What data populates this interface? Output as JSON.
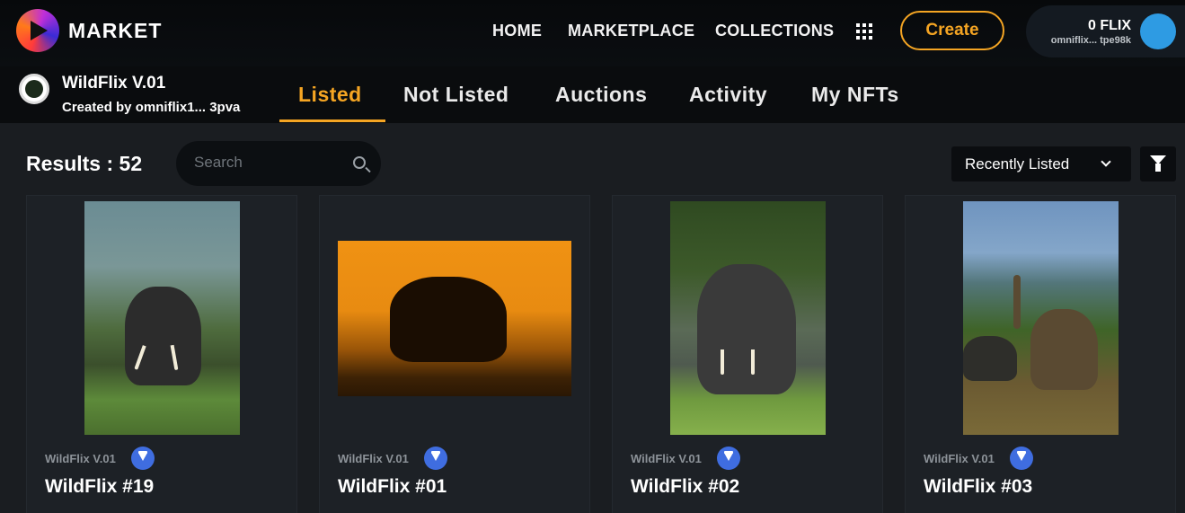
{
  "topnav": {
    "brand": "MARKET",
    "links": [
      "HOME",
      "MARKETPLACE",
      "COLLECTIONS"
    ],
    "create_label": "Create",
    "wallet": {
      "balance": "0 FLIX",
      "address": "omniflix...  tpe98k"
    }
  },
  "collection": {
    "name": "WildFlix V.01",
    "created_by": "Created by  omniflix1...  3pva",
    "tabs": [
      "Listed",
      "Not Listed",
      "Auctions",
      "Activity",
      "My NFTs"
    ],
    "active_tab": "Listed"
  },
  "toolbar": {
    "results": "Results : 52",
    "search_placeholder": "Search",
    "sort_label": "Recently Listed"
  },
  "cards": [
    {
      "collection": "WildFlix V.01",
      "title": "WildFlix #19",
      "image": "elephant-tusker-grassland"
    },
    {
      "collection": "WildFlix V.01",
      "title": "WildFlix #01",
      "image": "elephant-silhouette-sunset"
    },
    {
      "collection": "WildFlix V.01",
      "title": "WildFlix #02",
      "image": "elephant-forest-tusker"
    },
    {
      "collection": "WildFlix V.01",
      "title": "WildFlix #03",
      "image": "elephant-herd-trunk-raised"
    }
  ],
  "colors": {
    "accent": "#f5a523",
    "verified": "#3f6de0",
    "avatar": "#2e9be3"
  }
}
